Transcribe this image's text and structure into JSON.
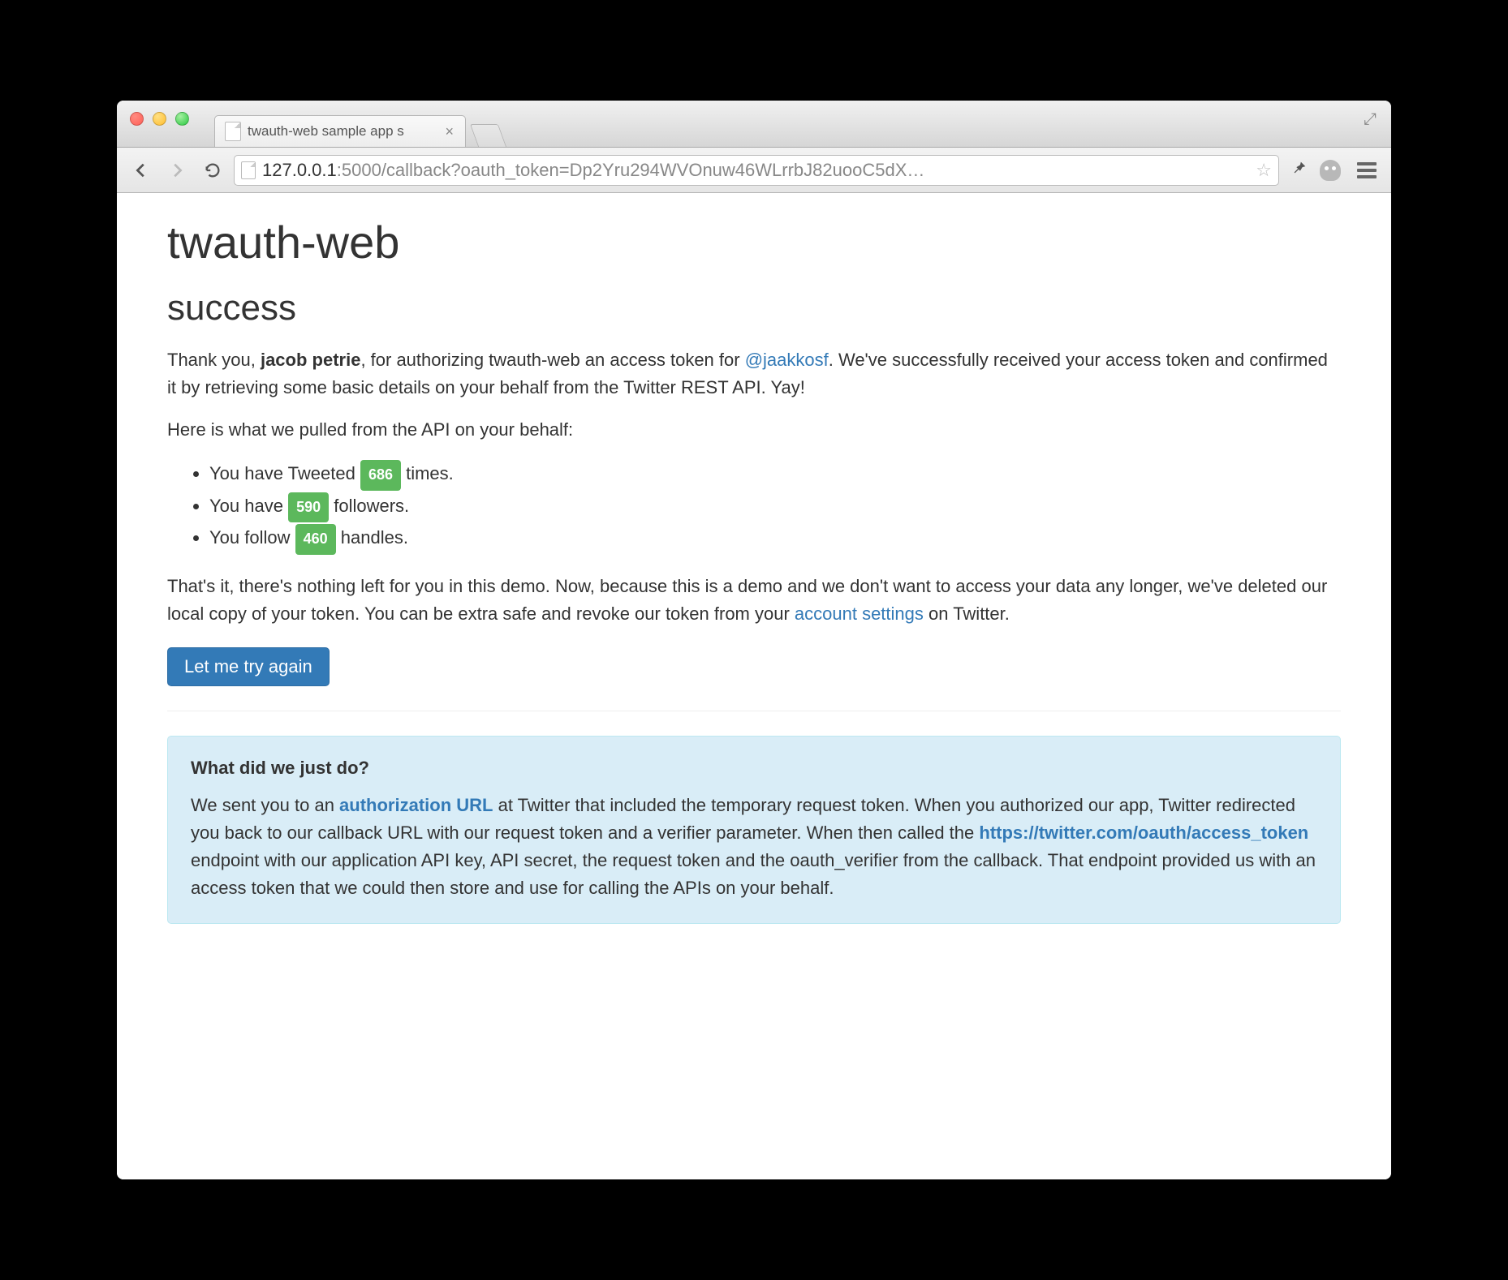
{
  "browser": {
    "tab_title": "twauth-web sample app s",
    "url_host": "127.0.0.1",
    "url_port": ":5000",
    "url_path": "/callback?oauth_token=Dp2Yru294WVOnuw46WLrrbJ82uooC5dX…"
  },
  "page": {
    "h1": "twauth-web",
    "h2": "success",
    "thank_prefix": "Thank you, ",
    "user_name": "jacob petrie",
    "thank_mid": ", for authorizing twauth-web an access token for ",
    "handle": "@jaakkosf",
    "thank_suffix": ". We've successfully received your access token and confirmed it by retrieving some basic details on your behalf from the Twitter REST API. Yay!",
    "pulled_intro": "Here is what we pulled from the API on your behalf:",
    "stats": {
      "tweets_pre": "You have Tweeted ",
      "tweets_count": "686",
      "tweets_post": " times.",
      "followers_pre": "You have ",
      "followers_count": "590",
      "followers_post": " followers.",
      "following_pre": "You follow ",
      "following_count": "460",
      "following_post": " handles."
    },
    "closing_pre": "That's it, there's nothing left for you in this demo. Now, because this is a demo and we don't want to access your data any longer, we've deleted our local copy of your token. You can be extra safe and revoke our token from your ",
    "closing_link": "account settings",
    "closing_post": " on Twitter.",
    "button_label": "Let me try again",
    "well": {
      "title": "What did we just do?",
      "p1": "We sent you to an ",
      "link1": "authorization URL",
      "p2": " at Twitter that included the temporary request token. When you authorized our app, Twitter redirected you back to our callback URL with our request token and a verifier parameter. When then called the ",
      "link2": "https://twitter.com/oauth/access_token",
      "p3": " endpoint with our application API key, API secret, the request token and the oauth_verifier from the callback. That endpoint provided us with an access token that we could then store and use for calling the APIs on your behalf."
    }
  }
}
